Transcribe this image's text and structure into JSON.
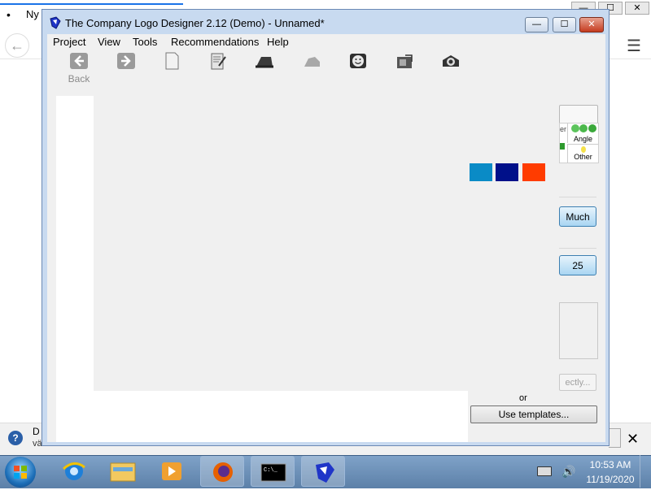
{
  "background_browser": {
    "tab_title": "Ny",
    "tab_bullet": "•",
    "back_glyph": "←",
    "menu_glyph": "☰",
    "infobar_first": "D",
    "infobar_second": "vältelimmän tilkat...",
    "infobar_close": "✕"
  },
  "window": {
    "title": "The Company Logo Designer 2.12 (Demo) - Unnamed*",
    "controls": {
      "minimize": "—",
      "maximize": "☐",
      "close": "✕"
    }
  },
  "menu": [
    "Project",
    "View",
    "Tools",
    "Recommendations",
    "Help"
  ],
  "toolbar": {
    "back_label": "Back",
    "buttons": [
      "back-icon",
      "forward-icon",
      "new-document-icon",
      "edit-document-icon",
      "hat-icon",
      "cloud-icon",
      "smiley-icon",
      "photo-icon",
      "camera-icon"
    ]
  },
  "swatches": [
    "#0a8bc6",
    "#00108a",
    "#ff3c00"
  ],
  "right_panel": {
    "grid_angle": "Angle",
    "grid_other": "Other",
    "grid_fragment": "er",
    "much_button": "Much",
    "value_25": "25",
    "disabled_button": "ectly...",
    "or_label": "or",
    "use_templates": "Use templates..."
  },
  "taskbar": {
    "time": "10:53 AM",
    "date": "11/19/2020"
  },
  "colors": {
    "titlebar": "#c8daf0",
    "taskbar": "#5c80a8"
  }
}
